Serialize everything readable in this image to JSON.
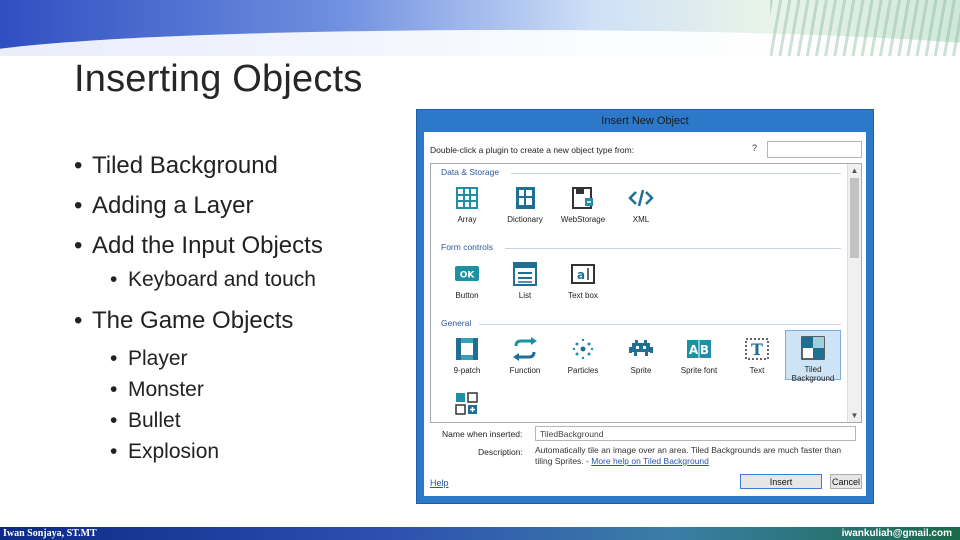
{
  "slide": {
    "title": "Inserting Objects",
    "bullets": [
      "Tiled Background",
      "Adding a Layer",
      "Add the Input Objects"
    ],
    "sub_bullets_1": [
      "Keyboard and touch"
    ],
    "bullet_4": "The Game Objects",
    "sub_bullets_2": [
      "Player",
      "Monster",
      "Bullet",
      "Explosion"
    ],
    "bullet_glyph": "•"
  },
  "dialog": {
    "title": "Insert New Object",
    "hint": "Double-click a plugin to create a new object type from:",
    "help_glyph": "?",
    "search_value": "",
    "sections": [
      {
        "label": "Data & Storage",
        "items": [
          {
            "label": "Array",
            "icon": "array-grid-icon"
          },
          {
            "label": "Dictionary",
            "icon": "dictionary-icon"
          },
          {
            "label": "WebStorage",
            "icon": "webstorage-icon"
          },
          {
            "label": "XML",
            "icon": "xml-code-icon"
          }
        ]
      },
      {
        "label": "Form controls",
        "items": [
          {
            "label": "Button",
            "icon": "ok-button-icon"
          },
          {
            "label": "List",
            "icon": "list-icon"
          },
          {
            "label": "Text box",
            "icon": "textbox-icon"
          }
        ]
      },
      {
        "label": "General",
        "items": [
          {
            "label": "9-patch",
            "icon": "nine-patch-icon"
          },
          {
            "label": "Function",
            "icon": "function-icon"
          },
          {
            "label": "Particles",
            "icon": "particles-icon"
          },
          {
            "label": "Sprite",
            "icon": "sprite-invader-icon"
          },
          {
            "label": "Sprite font",
            "icon": "sprite-font-icon"
          },
          {
            "label": "Text",
            "icon": "text-t-icon"
          },
          {
            "label": "Tiled Background",
            "icon": "tiled-background-icon"
          }
        ]
      }
    ],
    "selected_item": "Tiled Background",
    "name_label": "Name when inserted:",
    "name_value": "TiledBackground",
    "desc_label": "Description:",
    "desc_text": "Automatically tile an image over an area. Tiled Backgrounds are much faster than tiling Sprites. -",
    "desc_link": "More help on Tiled Background",
    "help_link": "Help",
    "insert_label": "Insert",
    "cancel_label": "Cancel",
    "scroll_up": "▲",
    "scroll_down": "▼"
  },
  "footer": {
    "left": "Iwan Sonjaya, ST.MT",
    "right": "iwankuliah@gmail.com"
  },
  "colors": {
    "dialog_frame": "#2c78c9",
    "icon_teal": "#1f8fa3",
    "section_text": "#2c5aa0",
    "link": "#2a52b5",
    "selection": "#cde4f7"
  }
}
